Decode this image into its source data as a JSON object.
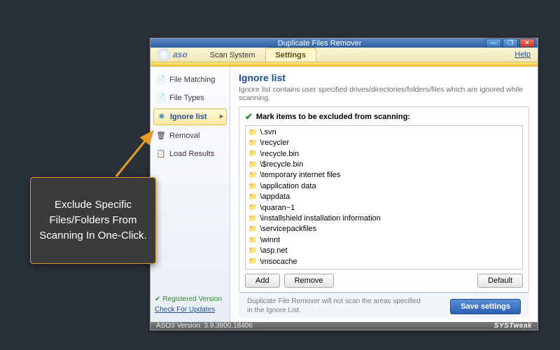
{
  "window": {
    "title": "Duplicate Files Remover"
  },
  "brand": "aso",
  "tabs": {
    "scan": "Scan System",
    "settings": "Settings"
  },
  "help": "Help",
  "sidebar": {
    "items": [
      {
        "label": "File Matching",
        "icon": "📄"
      },
      {
        "label": "File Types",
        "icon": "📄"
      },
      {
        "label": "Ignore list",
        "icon": "✳",
        "active": true
      },
      {
        "label": "Removal",
        "icon": "🗑"
      },
      {
        "label": "Load Results",
        "icon": "📋"
      }
    ],
    "registered": "Registered Version",
    "check_updates": "Check For Updates"
  },
  "content": {
    "heading": "Ignore list",
    "desc": "Ignore list contains user specified drives/directories/folders/files which are ignored while scanning.",
    "panel_title": "Mark items to be excluded from scanning:",
    "items": [
      "\\.svn",
      "\\recycler",
      "\\recycle.bin",
      "\\$recycle.bin",
      "\\temporary internet files",
      "\\application data",
      "\\appdata",
      "\\quaran~1",
      "\\installshield installation information",
      "\\servicepackfiles",
      "\\winnt",
      "\\asp.net",
      "\\msocache"
    ],
    "buttons": {
      "add": "Add",
      "remove": "Remove",
      "default": "Default"
    }
  },
  "footer": {
    "note_l1": "Duplicate File Remover will not scan the areas specified",
    "note_l2": "in the Ignore List.",
    "save": "Save settings"
  },
  "statusbar": {
    "version": "ASO3 Version: 3.9.3800.18406",
    "brand": "SYSTweak"
  },
  "callout": "Exclude Specific Files/Folders From Scanning In One-Click."
}
